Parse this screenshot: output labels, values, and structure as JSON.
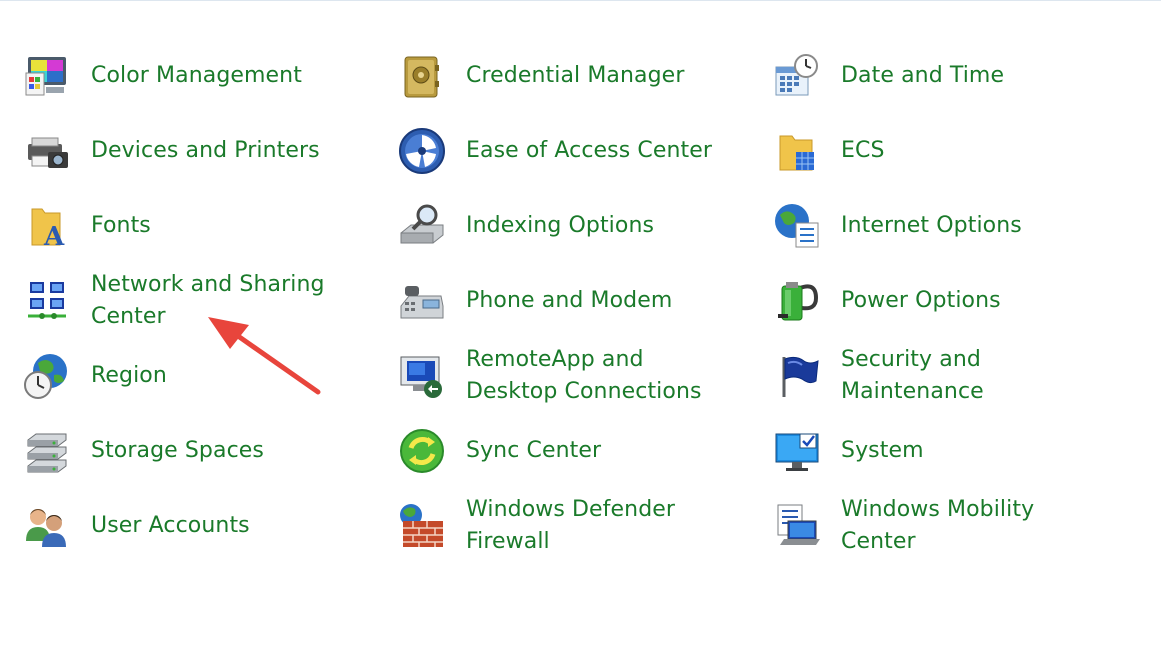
{
  "items": [
    {
      "label": "Color Management",
      "icon": "color-management-icon"
    },
    {
      "label": "Credential Manager",
      "icon": "credential-manager-icon"
    },
    {
      "label": "Date and Time",
      "icon": "date-time-icon"
    },
    {
      "label": "Devices and Printers",
      "icon": "devices-printers-icon"
    },
    {
      "label": "Ease of Access Center",
      "icon": "ease-of-access-icon"
    },
    {
      "label": "ECS",
      "icon": "ecs-folder-icon"
    },
    {
      "label": "Fonts",
      "icon": "fonts-folder-icon"
    },
    {
      "label": "Indexing Options",
      "icon": "indexing-options-icon"
    },
    {
      "label": "Internet Options",
      "icon": "internet-options-icon"
    },
    {
      "label": "Network and Sharing Center",
      "icon": "network-sharing-icon"
    },
    {
      "label": "Phone and Modem",
      "icon": "phone-modem-icon"
    },
    {
      "label": "Power Options",
      "icon": "power-options-icon"
    },
    {
      "label": "Region",
      "icon": "region-icon"
    },
    {
      "label": "RemoteApp and Desktop Connections",
      "icon": "remoteapp-icon"
    },
    {
      "label": "Security and Maintenance",
      "icon": "security-flag-icon"
    },
    {
      "label": "Storage Spaces",
      "icon": "storage-spaces-icon"
    },
    {
      "label": "Sync Center",
      "icon": "sync-center-icon"
    },
    {
      "label": "System",
      "icon": "system-monitor-icon"
    },
    {
      "label": "User Accounts",
      "icon": "user-accounts-icon"
    },
    {
      "label": "Windows Defender Firewall",
      "icon": "firewall-icon"
    },
    {
      "label": "Windows Mobility Center",
      "icon": "mobility-center-icon"
    }
  ],
  "colors": {
    "link": "#1a7a2a",
    "annotation_arrow": "#e8453c"
  },
  "annotation": {
    "icon": "red-arrow-annotation",
    "target": "Network and Sharing Center"
  }
}
